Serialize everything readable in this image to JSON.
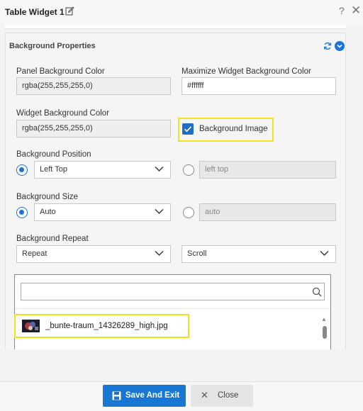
{
  "window": {
    "title": "Table Widget 1",
    "help": "?",
    "close": "✕"
  },
  "panel": {
    "title": "Background Properties",
    "panel_bg": {
      "label": "Panel Background Color",
      "value": "rgba(255,255,255,0)"
    },
    "max_bg": {
      "label": "Maximize Widget Background Color",
      "value": "#ffffff"
    },
    "widget_bg": {
      "label": "Widget Background Color",
      "value": "rgba(255,255,255,0)"
    },
    "bg_image": {
      "label": "Background Image",
      "checked": true
    },
    "position": {
      "label": "Background Position",
      "select": "Left Top",
      "custom_placeholder": "left top"
    },
    "size": {
      "label": "Background Size",
      "select": "Auto",
      "custom_placeholder": "auto"
    },
    "repeat": {
      "label": "Background Repeat",
      "select": "Repeat",
      "attachment": "Scroll"
    },
    "image_list": {
      "search_value": "",
      "files": [
        "_bunte-traum_14326289_high.jpg"
      ]
    }
  },
  "footer": {
    "save": "Save And Exit",
    "close": "Close"
  },
  "colors": {
    "accent": "#1877d2",
    "highlight": "#f2e21a"
  }
}
